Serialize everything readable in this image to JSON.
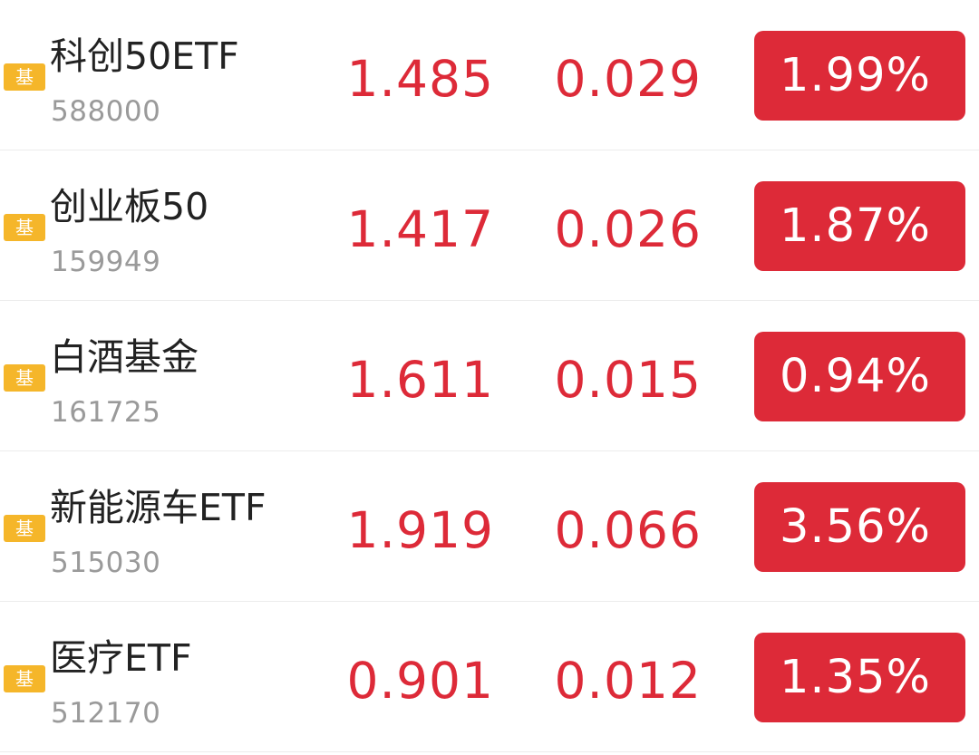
{
  "colors": {
    "up": "#dd2a38",
    "badge": "#f5b62a",
    "name": "#222222",
    "code": "#9a9a9a",
    "divider": "#ececec"
  },
  "funds": [
    {
      "badge": "基",
      "name": "科创50ETF",
      "code": "588000",
      "price": "1.485",
      "change": "0.029",
      "pct": "1.99%"
    },
    {
      "badge": "基",
      "name": "创业板50",
      "code": "159949",
      "price": "1.417",
      "change": "0.026",
      "pct": "1.87%"
    },
    {
      "badge": "基",
      "name": "白酒基金",
      "code": "161725",
      "price": "1.611",
      "change": "0.015",
      "pct": "0.94%"
    },
    {
      "badge": "基",
      "name": "新能源车ETF",
      "code": "515030",
      "price": "1.919",
      "change": "0.066",
      "pct": "3.56%"
    },
    {
      "badge": "基",
      "name": "医疗ETF",
      "code": "512170",
      "price": "0.901",
      "change": "0.012",
      "pct": "1.35%"
    }
  ]
}
